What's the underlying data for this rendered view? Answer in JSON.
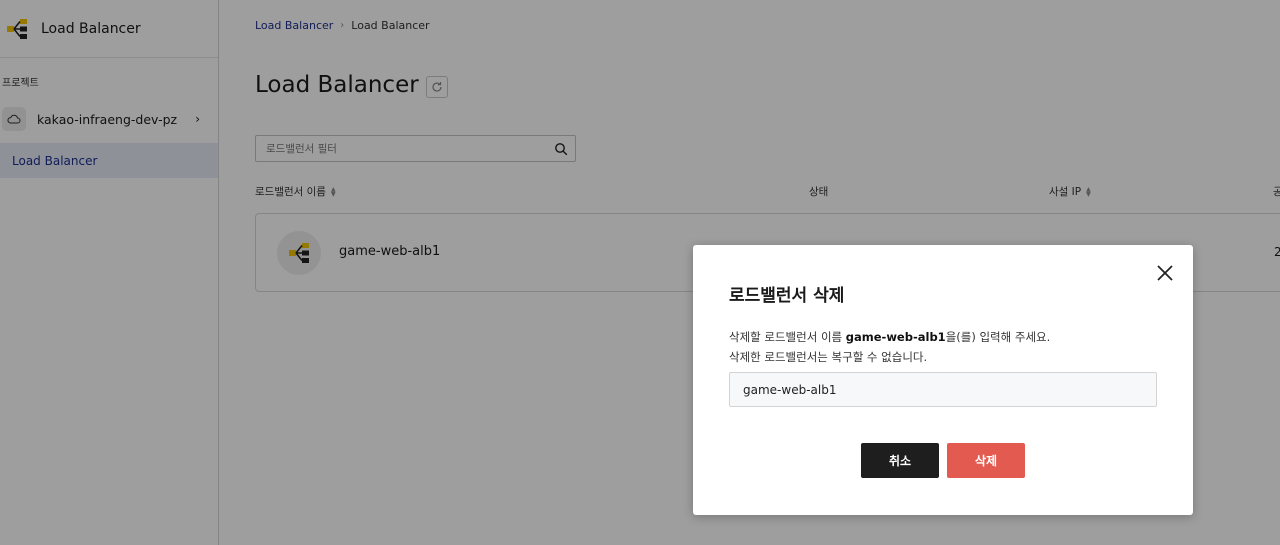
{
  "sidebar": {
    "title": "Load Balancer",
    "logo_icon": "load-balancer-icon",
    "section_label": "프로젝트",
    "project": {
      "name": "kakao-infraeng-dev-pz",
      "icon": "cloud-icon",
      "chevron": "›"
    },
    "items": [
      {
        "label": "Load Balancer",
        "active": true
      }
    ]
  },
  "breadcrumb": {
    "items": [
      "Load Balancer",
      "Load Balancer"
    ],
    "separator": "›"
  },
  "header": {
    "title": "Load Balancer",
    "refresh_icon": "refresh-icon"
  },
  "filter": {
    "placeholder": "로드밸런서 필터",
    "icon": "search-icon"
  },
  "table": {
    "columns": [
      {
        "label": "로드밸런서 이름",
        "sortable": true
      },
      {
        "label": "상태",
        "sortable": false
      },
      {
        "label": "사설 IP",
        "sortable": true
      },
      {
        "label": "공",
        "sortable": false
      }
    ],
    "rows": [
      {
        "name": "game-web-alb1",
        "icon": "load-balancer-icon",
        "ip_truncated": "2"
      }
    ]
  },
  "modal": {
    "title": "로드밸런서 삭제",
    "desc_prefix": "삭제할 로드밸런서 이름 ",
    "desc_name": "game-web-alb1",
    "desc_suffix": "을(를) 입력해 주세요.",
    "desc_line2": "삭제한 로드밸런서는 복구할 수 없습니다.",
    "input_value": "game-web-alb1",
    "cancel_label": "취소",
    "delete_label": "삭제",
    "close_icon": "close-icon"
  },
  "colors": {
    "accent_blue": "#1f2f8f",
    "delete_red": "#e35b50",
    "cancel_black": "#1e1e1e",
    "logo_yellow": "#f2c300"
  }
}
